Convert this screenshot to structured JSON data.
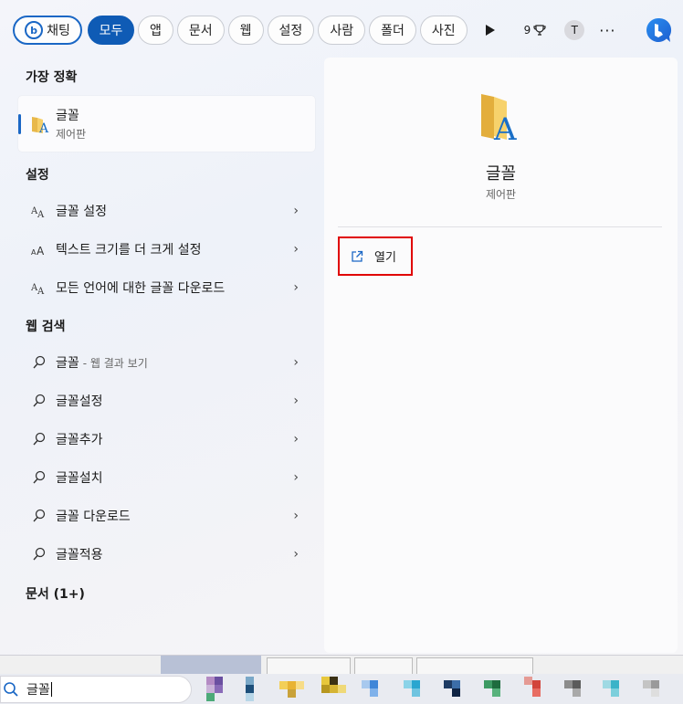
{
  "filters": {
    "chat_label": "채팅",
    "items": [
      {
        "label": "모두",
        "active": true
      },
      {
        "label": "앱"
      },
      {
        "label": "문서"
      },
      {
        "label": "웹"
      },
      {
        "label": "설정"
      },
      {
        "label": "사람"
      },
      {
        "label": "폴더"
      },
      {
        "label": "사진"
      }
    ],
    "points": "9",
    "avatar_initial": "T",
    "more": "···"
  },
  "left": {
    "best_match_heading": "가장 정확",
    "best_match": {
      "title": "글꼴",
      "subtitle": "제어판"
    },
    "settings_heading": "설정",
    "settings": [
      {
        "label": "글꼴 설정"
      },
      {
        "label": "텍스트 크기를 더 크게 설정"
      },
      {
        "label": "모든 언어에 대한 글꼴 다운로드"
      }
    ],
    "web_heading": "웹 검색",
    "web": [
      {
        "label": "글꼴",
        "hint": "- 웹 결과 보기"
      },
      {
        "label": "글꼴설정"
      },
      {
        "label": "글꼴추가"
      },
      {
        "label": "글꼴설치"
      },
      {
        "label": "글꼴 다운로드"
      },
      {
        "label": "글꼴적용"
      }
    ],
    "docs_heading": "문서 (1+)"
  },
  "preview": {
    "title": "글꼴",
    "subtitle": "제어판",
    "open_label": "열기"
  },
  "taskbar": {
    "search_value": "글꼴"
  },
  "colors": {
    "accent": "#1a67c5",
    "highlight_box": "#e00000"
  }
}
